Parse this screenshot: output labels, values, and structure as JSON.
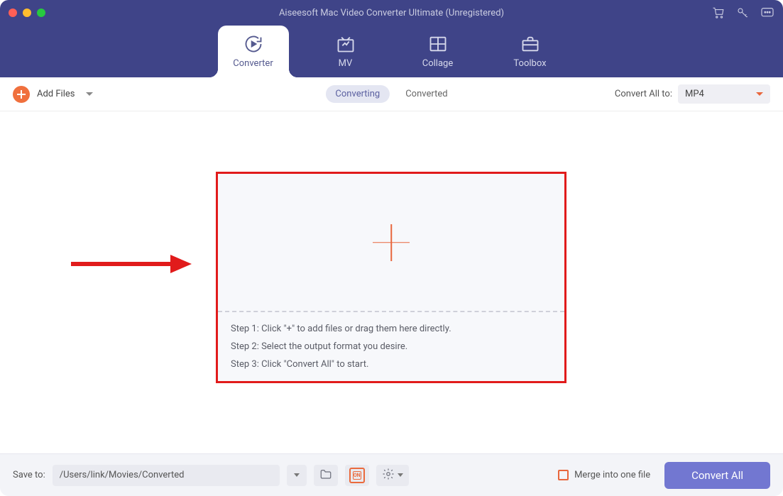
{
  "title": "Aiseesoft Mac Video Converter Ultimate (Unregistered)",
  "tabs": {
    "converter": "Converter",
    "mv": "MV",
    "collage": "Collage",
    "toolbox": "Toolbox"
  },
  "toolbar": {
    "add_files": "Add Files",
    "converting": "Converting",
    "converted": "Converted",
    "convert_all_to": "Convert All to:",
    "selected_format": "MP4"
  },
  "dropzone": {
    "step1": "Step 1: Click \"+\" to add files or drag them here directly.",
    "step2": "Step 2: Select the output format you desire.",
    "step3": "Step 3: Click \"Convert All\" to start."
  },
  "bottom": {
    "save_to_label": "Save to:",
    "save_path": "/Users/link/Movies/Converted",
    "gpu_text": "ON",
    "merge_label": "Merge into one file",
    "convert_all_btn": "Convert All"
  },
  "colors": {
    "accent_orange": "#e8663c",
    "header_purple": "#3f4488",
    "button_purple": "#7277d1",
    "annotation_red": "#e11b1b"
  }
}
